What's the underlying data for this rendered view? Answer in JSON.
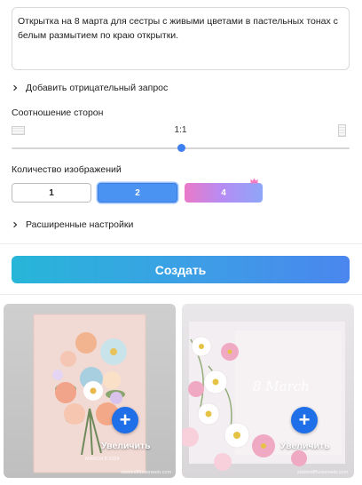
{
  "prompt": {
    "text": "Открытка на 8 марта для сестры с живыми цветами в пастельных тонах с белым размытием по краю открытки."
  },
  "negative_prompt": {
    "label": "Добавить отрицательный запрос"
  },
  "aspect_ratio": {
    "label": "Соотношение сторон",
    "value": "1:1",
    "slider_fraction": 0.5
  },
  "image_count": {
    "label": "Количество изображений",
    "options": [
      "1",
      "2",
      "4"
    ],
    "selected": "2"
  },
  "advanced": {
    "label": "Расширенные настройки"
  },
  "create_button": {
    "label": "Создать"
  },
  "results": [
    {
      "zoom_label": "Увеличить",
      "card_text": "MARCH 8 2024",
      "watermark": "stablediffusionweb.com"
    },
    {
      "zoom_label": "Увеличить",
      "card_text": "8 March",
      "watermark": "stablediffusionweb.com"
    }
  ],
  "colors": {
    "accent": "#4b93f2",
    "create_gradient_start": "#27b6d8",
    "create_gradient_end": "#4a86ee",
    "premium_gradient": "#ea79c9"
  }
}
